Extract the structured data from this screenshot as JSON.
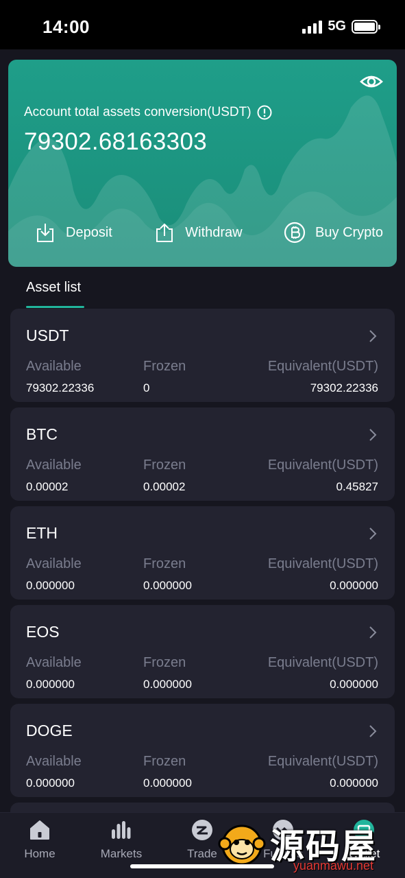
{
  "status_bar": {
    "time": "14:00",
    "network": "5G"
  },
  "account": {
    "label": "Account total assets conversion(USDT)",
    "total": "79302.68163303",
    "actions": [
      {
        "label": "Deposit",
        "icon": "deposit-icon"
      },
      {
        "label": "Withdraw",
        "icon": "withdraw-icon"
      },
      {
        "label": "Buy Crypto",
        "icon": "bitcoin-icon"
      }
    ],
    "accent_color": "#1f9e89"
  },
  "asset_list": {
    "tab_label": "Asset list",
    "column_labels": {
      "available": "Available",
      "frozen": "Frozen",
      "equivalent": "Equivalent(USDT)"
    },
    "items": [
      {
        "symbol": "USDT",
        "available": "79302.22336",
        "frozen": "0",
        "equivalent": "79302.22336"
      },
      {
        "symbol": "BTC",
        "available": "0.00002",
        "frozen": "0.00002",
        "equivalent": "0.45827"
      },
      {
        "symbol": "ETH",
        "available": "0.000000",
        "frozen": "0.000000",
        "equivalent": "0.000000"
      },
      {
        "symbol": "EOS",
        "available": "0.000000",
        "frozen": "0.000000",
        "equivalent": "0.000000"
      },
      {
        "symbol": "DOGE",
        "available": "0.000000",
        "frozen": "0.000000",
        "equivalent": "0.000000"
      }
    ]
  },
  "bottom_nav": {
    "items": [
      {
        "label": "Home",
        "icon": "home-icon"
      },
      {
        "label": "Markets",
        "icon": "markets-icon"
      },
      {
        "label": "Trade",
        "icon": "trade-icon"
      },
      {
        "label": "Futures",
        "icon": "futures-icon"
      },
      {
        "label": "Wallet",
        "icon": "wallet-icon"
      }
    ],
    "active": "Wallet"
  },
  "watermark": {
    "text_cn": "源码屋",
    "url": "yuanmawu.net"
  }
}
